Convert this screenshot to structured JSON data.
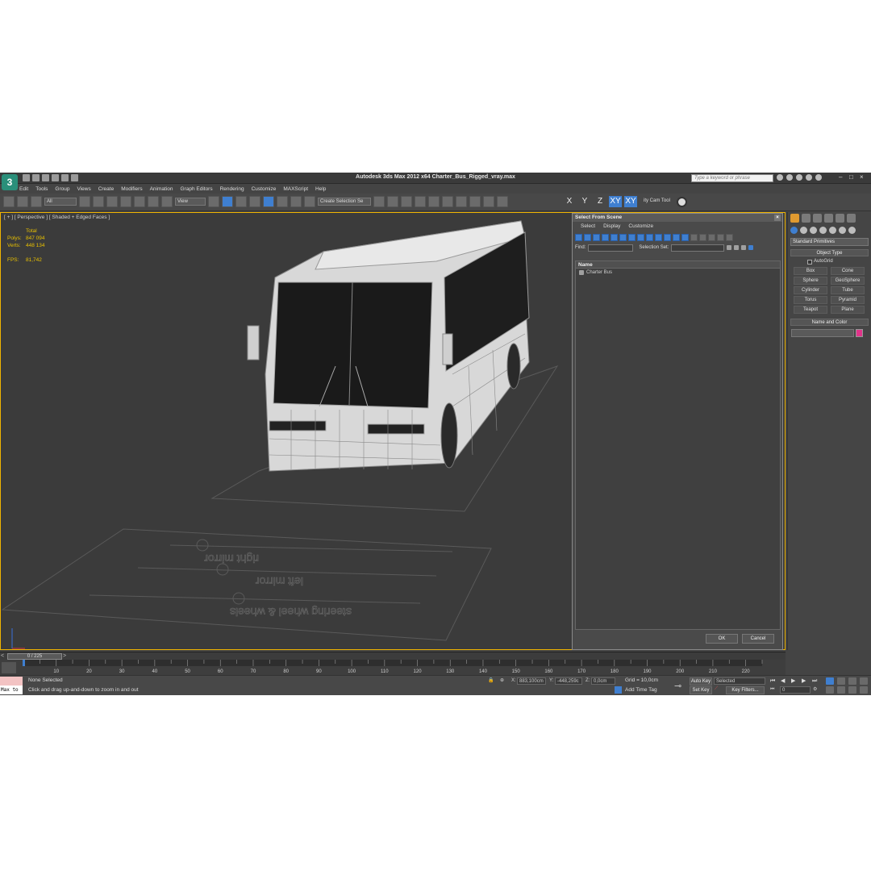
{
  "titlebar": {
    "title": "Autodesk 3ds Max  2012 x64     Charter_Bus_Rigged_vray.max",
    "search_placeholder": "Type a keyword or phrase"
  },
  "menu": [
    "Edit",
    "Tools",
    "Group",
    "Views",
    "Create",
    "Modifiers",
    "Animation",
    "Graph Editors",
    "Rendering",
    "Customize",
    "MAXScript",
    "Help"
  ],
  "toolbar": {
    "selection_filter": "All",
    "ref_coord": "View",
    "selection_set_placeholder": "Create Selection Se",
    "axis": [
      "X",
      "Y",
      "Z",
      "XY",
      "XY"
    ],
    "cam_tool": "ity Cam Tool"
  },
  "viewport": {
    "label": "[ + ] [ Perspective ] [ Shaded + Edged Faces ]",
    "stats_header": "Total",
    "stats": [
      {
        "k": "Polys:",
        "v": "847 094"
      },
      {
        "k": "Verts:",
        "v": "448 134"
      }
    ],
    "fps_label": "FPS:",
    "fps_value": "81,742",
    "floor_labels": [
      "right mirror",
      "left mirror",
      "steering wheel & wheels"
    ]
  },
  "dialog": {
    "title": "Select From Scene",
    "menu": [
      "Select",
      "Display",
      "Customize"
    ],
    "find_label": "Find:",
    "selection_set_label": "Selection Set:",
    "column_name": "Name",
    "items": [
      "Charter Bus"
    ],
    "ok": "OK",
    "cancel": "Cancel"
  },
  "command_panel": {
    "category": "Standard Primitives",
    "object_type_header": "Object Type",
    "autogrid": "AutoGrid",
    "primitives": [
      "Box",
      "Cone",
      "Sphere",
      "GeoSphere",
      "Cylinder",
      "Tube",
      "Torus",
      "Pyramid",
      "Teapot",
      "Plane"
    ],
    "name_color_header": "Name and Color",
    "color": "#e0338a"
  },
  "timeline": {
    "slider": "0 / 225",
    "ticks": [
      10,
      20,
      30,
      40,
      50,
      60,
      70,
      80,
      90,
      100,
      110,
      120,
      130,
      140,
      150,
      160,
      170,
      180,
      190,
      200,
      210,
      220
    ]
  },
  "status": {
    "maxscript": "Max to",
    "selection": "None Selected",
    "prompt": "Click and drag up-and-down to zoom in and out",
    "x_label": "X:",
    "x_value": "883,100cm",
    "y_label": "Y:",
    "y_value": "-448,259c",
    "z_label": "Z:",
    "z_value": "0,0cm",
    "grid": "Grid = 10,0cm",
    "add_time_tag": "Add Time Tag",
    "auto_key": "Auto Key",
    "set_key": "Set Key",
    "key_mode": "Selected",
    "key_filters": "Key Filters...",
    "frame": "0"
  }
}
